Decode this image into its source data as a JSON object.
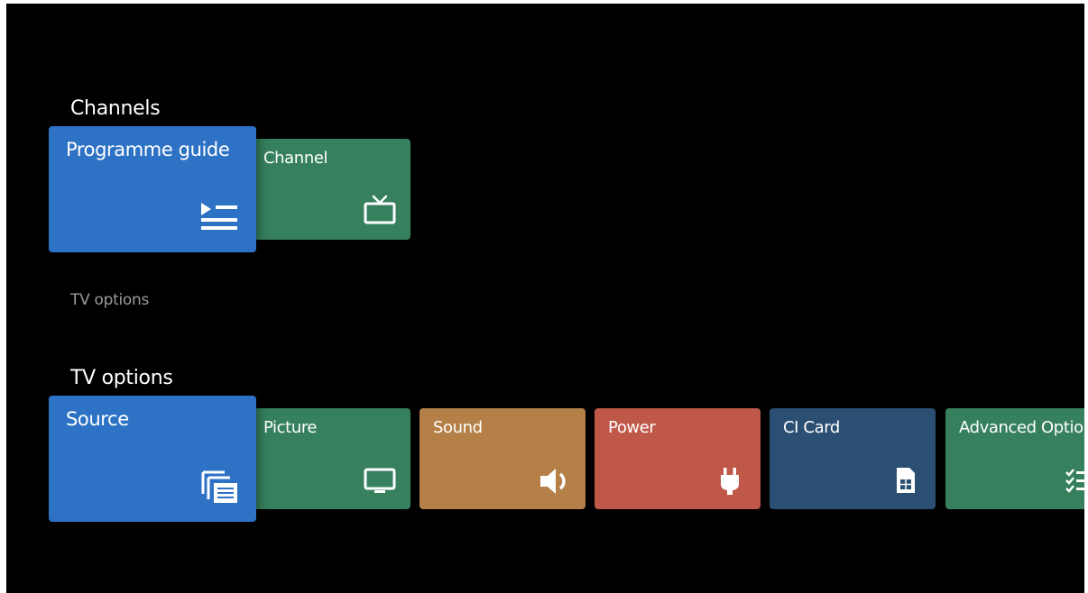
{
  "channels_section": {
    "title": "Channels",
    "tiles": [
      {
        "label": "Programme guide",
        "icon": "programme-guide-icon",
        "color": "#2d72c4"
      },
      {
        "label": "Channel",
        "icon": "tv-icon",
        "color": "#36805e"
      }
    ]
  },
  "tv_options_hint": "TV options",
  "tv_options_section": {
    "title": "TV options",
    "tiles": [
      {
        "label": "Source",
        "icon": "source-icon",
        "color": "#2d72c4"
      },
      {
        "label": "Picture",
        "icon": "monitor-icon",
        "color": "#36805e"
      },
      {
        "label": "Sound",
        "icon": "speaker-icon",
        "color": "#b57f48"
      },
      {
        "label": "Power",
        "icon": "plug-icon",
        "color": "#c0584a"
      },
      {
        "label": "CI Card",
        "icon": "sim-card-icon",
        "color": "#2b4f72"
      },
      {
        "label": "Advanced Options",
        "icon": "checklist-icon",
        "color": "#36805e"
      }
    ]
  },
  "colors": {
    "background": "#000000",
    "focused_tile": "#2d72c4",
    "green_tile": "#36805e",
    "orange_tile": "#b57f48",
    "red_tile": "#c0584a",
    "navy_tile": "#2b4f72",
    "hint_text": "#9a9a9a"
  }
}
